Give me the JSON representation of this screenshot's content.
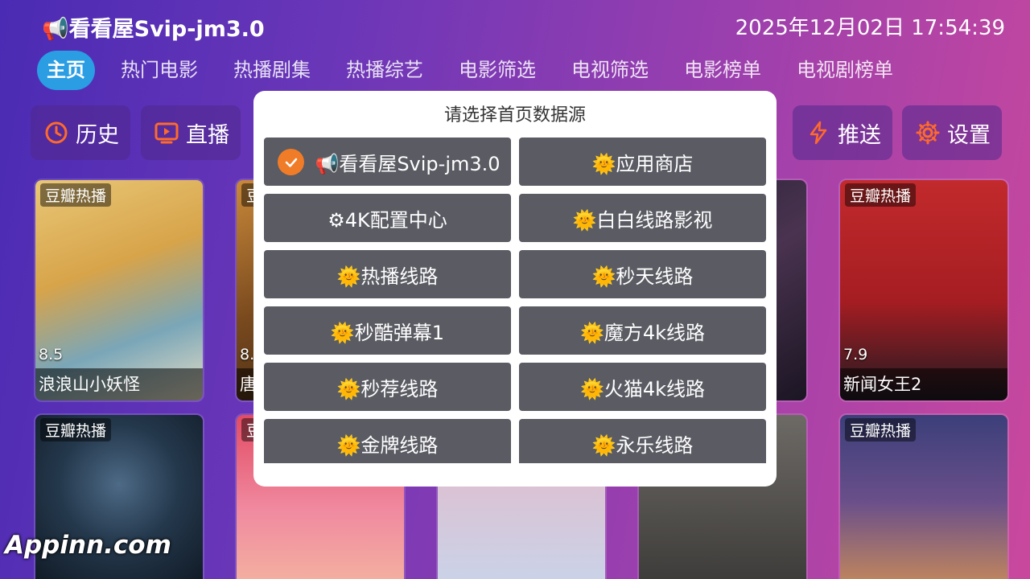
{
  "header": {
    "app_title": "📢看看屋Svip-jm3.0",
    "datetime": "2025年12月02日 17:54:39"
  },
  "nav": {
    "items": [
      "主页",
      "热门电影",
      "热播剧集",
      "热播综艺",
      "电影筛选",
      "电视筛选",
      "电影榜单",
      "电视剧榜单"
    ],
    "active": "主页"
  },
  "quick": {
    "history": "历史",
    "live": "直播",
    "push": "推送",
    "settings": "设置"
  },
  "cards": [
    {
      "tag": "豆瓣热播",
      "score": "8.5",
      "title": "浪浪山小妖怪"
    },
    {
      "tag": "豆",
      "score": "8.",
      "title": "唐"
    },
    {
      "tag": "豆瓣热播",
      "score": "7.9",
      "title": "新闻女王2"
    },
    {
      "tag": "豆瓣热播"
    },
    {
      "tag": "豆"
    },
    {
      "tag": "豆瓣热播"
    }
  ],
  "dialog": {
    "title": "请选择首页数据源",
    "sources": [
      "📢看看屋Svip-jm3.0",
      "🌞应用商店",
      "⚙4K配置中心",
      "🌞白白线路影视",
      "🌞热播线路",
      "🌞秒天线路",
      "🌞秒酷弹幕1",
      "🌞魔方4k线路",
      "🌞秒荐线路",
      "🌞火猫4k线路",
      "🌞金牌线路",
      "🌞永乐线路"
    ],
    "selected": "📢看看屋Svip-jm3.0"
  },
  "watermark": "Appinn.com",
  "colors": {
    "accent": "#2a9de3",
    "check": "#f07c28",
    "icon": "#ff6a2b"
  }
}
